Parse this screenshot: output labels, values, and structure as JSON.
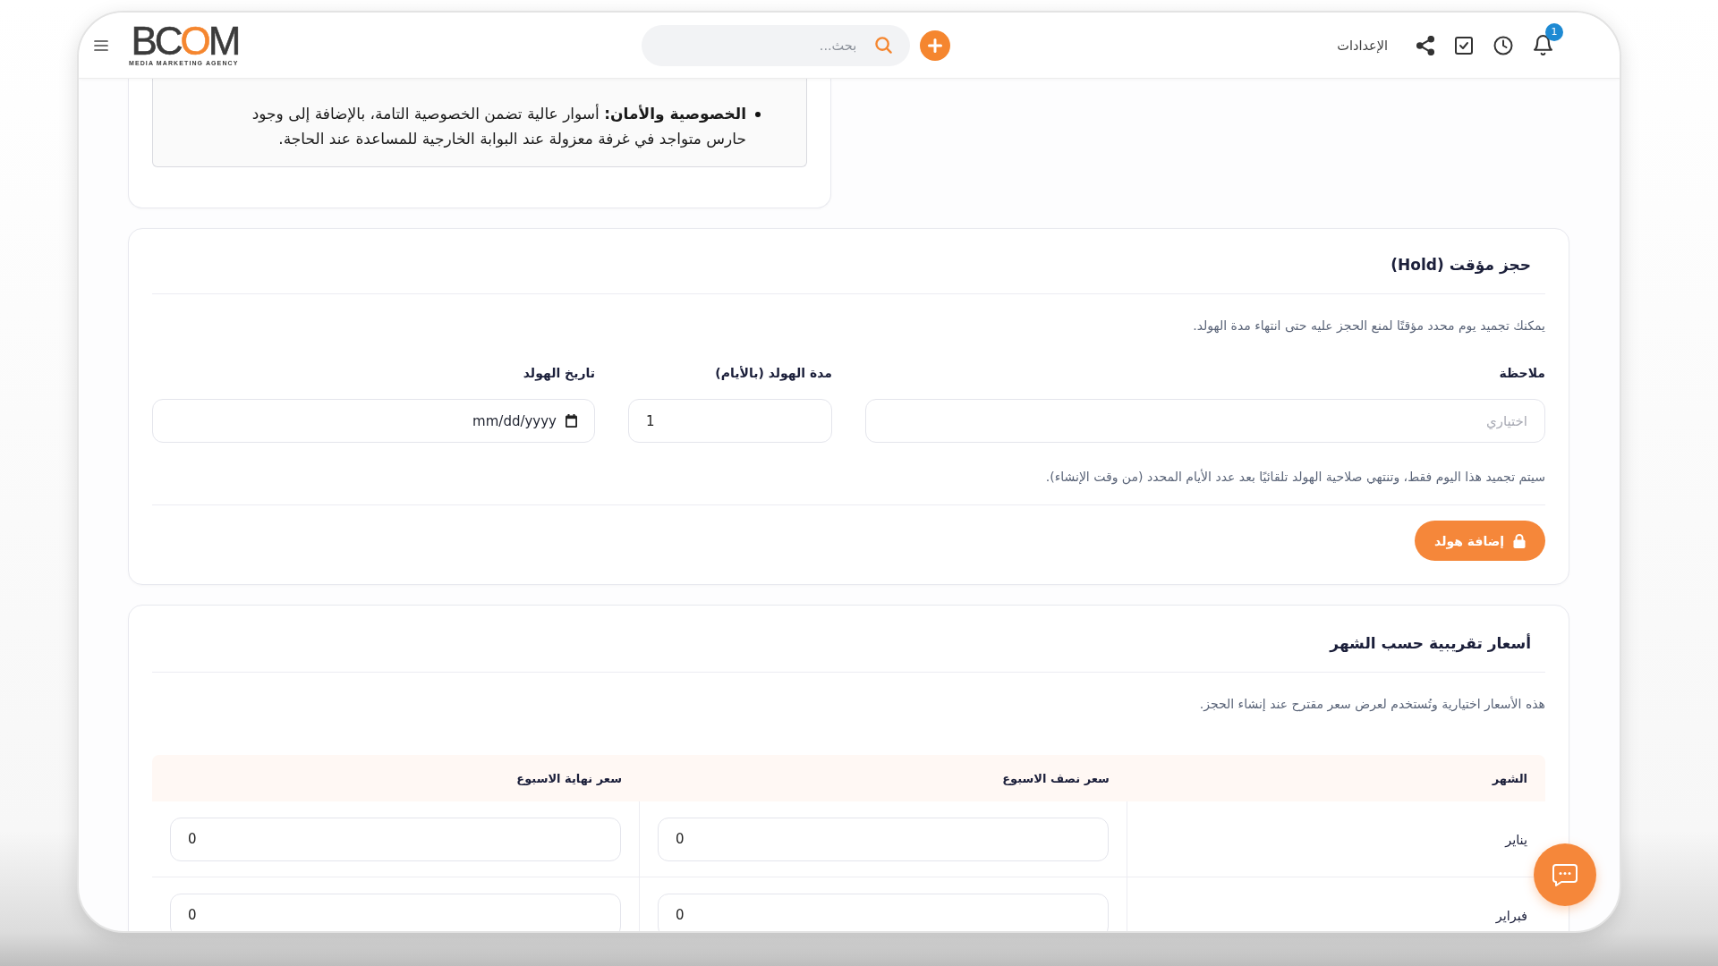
{
  "header": {
    "logo": {
      "wordmark": {
        "start": "BC",
        "accent": "O",
        "end": "M"
      },
      "tagline": "MEDIA MARKETING AGENCY"
    },
    "search": {
      "placeholder": "بحث..."
    },
    "settings_link": "الإعدادات",
    "notification_count": "1"
  },
  "features": {
    "items": [
      "**الخصوصية والأمان:** أسوار عالية تضمن الخصوصية التامة، بالإضافة إلى وجود حارس متواجد في غرفة معزولة عند البوابة الخارجية للمساعدة عند الحاجة."
    ]
  },
  "hold": {
    "title": "حجز مؤقت (Hold)",
    "description": "يمكنك تجميد يوم محدد مؤقتًا لمنع الحجز عليه حتى انتهاء مدة الهولد.",
    "fields": [
      {
        "kind": "text",
        "label": "ملاحظة",
        "placeholder": "اختياري"
      },
      {
        "kind": "number",
        "label": "مدة الهولد (بالأيام)",
        "value": "1"
      },
      {
        "kind": "date",
        "label": "تاريخ الهولد",
        "placeholder": "mm/dd/yyyy"
      }
    ],
    "hint": "سيتم تجميد هذا اليوم فقط، وتنتهي صلاحية الهولد تلقائيًا بعد عدد الأيام المحدد (من وقت الإنشاء).",
    "submit_button": "إضافة هولد"
  },
  "monthly_prices": {
    "title": "أسعار تقريبية حسب الشهر",
    "description": "هذه الأسعار اختيارية وتُستخدم لعرض سعر مقترح عند إنشاء الحجز.",
    "table": {
      "columns": [
        "الشهر",
        "سعر نصف الاسبوع",
        "سعر نهاية الاسبوع"
      ],
      "rows": [
        [
          "يناير",
          "0",
          "0"
        ],
        [
          "فبراير",
          "0",
          "0"
        ]
      ]
    }
  }
}
